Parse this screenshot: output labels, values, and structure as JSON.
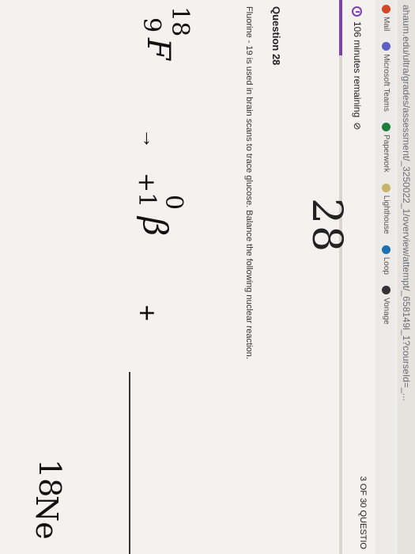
{
  "browser": {
    "url": "ahaum.edu/ultra/grades/assessment/_3250022_1/overview/attempt/_658149l_1?courseId=_..."
  },
  "bookmarks": [
    {
      "label": "Mail",
      "icon": "office-icon",
      "color": "#d24726"
    },
    {
      "label": "Microsoft Teams",
      "icon": "teams-icon",
      "color": "#5b5fc7"
    },
    {
      "label": "Paperwork",
      "icon": "paperwork-icon",
      "color": "#1e7d3a"
    },
    {
      "label": "Lighthouse",
      "icon": "lighthouse-icon",
      "color": "#c7b46a"
    },
    {
      "label": "Loop",
      "icon": "loop-icon",
      "color": "#1b6fb3"
    },
    {
      "label": "Vonage",
      "icon": "vonage-icon",
      "color": "#333333"
    }
  ],
  "quiz": {
    "timer_text": "106 minutes remaining",
    "question_count": "3 OF 30 QUESTIO",
    "progress_fraction": 0.1,
    "accent_color": "#7e3fb3",
    "large_number": "28",
    "question_title": "Question 28",
    "question_text": "Fluorine - 19 is used in brain scans to trace glucose. Balance the following nuclear reaction."
  },
  "equation": {
    "reactant": {
      "mass": "18",
      "atomic": "9",
      "symbol": "F"
    },
    "arrow": "→",
    "product1": {
      "mass": "0",
      "atomic": "+1",
      "symbol": "β"
    },
    "plus": "+",
    "product2": {
      "mass": "18",
      "symbol": "Ne"
    }
  }
}
